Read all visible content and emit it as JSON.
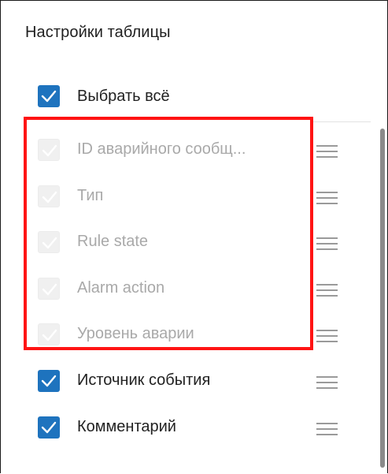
{
  "panel": {
    "title": "Настройки таблицы"
  },
  "select_all": {
    "label": "Выбрать всё",
    "checked": true
  },
  "columns": [
    {
      "label": "ID аварийного сообщ...",
      "checked": true,
      "disabled": true
    },
    {
      "label": "Тип",
      "checked": true,
      "disabled": true
    },
    {
      "label": "Rule state",
      "checked": true,
      "disabled": true
    },
    {
      "label": "Alarm action",
      "checked": true,
      "disabled": true
    },
    {
      "label": "Уровень аварии",
      "checked": true,
      "disabled": true
    },
    {
      "label": "Источник события",
      "checked": true,
      "disabled": false
    },
    {
      "label": "Комментарий",
      "checked": true,
      "disabled": false
    }
  ],
  "colors": {
    "accent": "#1e73be",
    "highlight_border": "#ff1414",
    "disabled_text": "#a9a9a9"
  },
  "icons": {
    "checkbox_check": "check-icon",
    "drag_handle": "drag-handle-icon"
  }
}
